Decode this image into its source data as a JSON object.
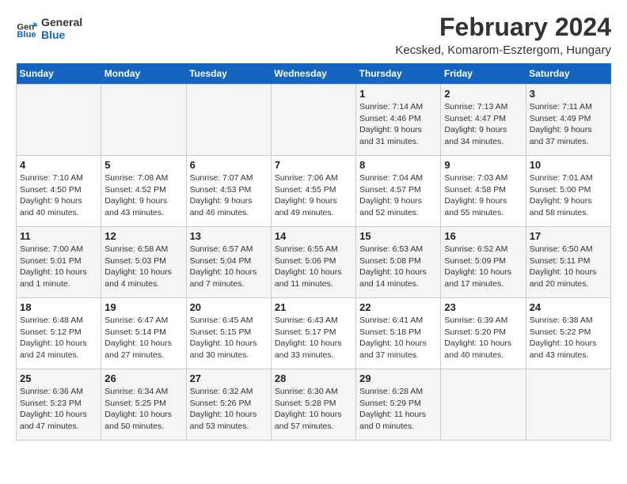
{
  "logo": {
    "line1": "General",
    "line2": "Blue"
  },
  "title": "February 2024",
  "subtitle": "Kecsked, Komarom-Esztergom, Hungary",
  "days_of_week": [
    "Sunday",
    "Monday",
    "Tuesday",
    "Wednesday",
    "Thursday",
    "Friday",
    "Saturday"
  ],
  "weeks": [
    [
      {
        "day": "",
        "info": ""
      },
      {
        "day": "",
        "info": ""
      },
      {
        "day": "",
        "info": ""
      },
      {
        "day": "",
        "info": ""
      },
      {
        "day": "1",
        "info": "Sunrise: 7:14 AM\nSunset: 4:46 PM\nDaylight: 9 hours\nand 31 minutes."
      },
      {
        "day": "2",
        "info": "Sunrise: 7:13 AM\nSunset: 4:47 PM\nDaylight: 9 hours\nand 34 minutes."
      },
      {
        "day": "3",
        "info": "Sunrise: 7:11 AM\nSunset: 4:49 PM\nDaylight: 9 hours\nand 37 minutes."
      }
    ],
    [
      {
        "day": "4",
        "info": "Sunrise: 7:10 AM\nSunset: 4:50 PM\nDaylight: 9 hours\nand 40 minutes."
      },
      {
        "day": "5",
        "info": "Sunrise: 7:08 AM\nSunset: 4:52 PM\nDaylight: 9 hours\nand 43 minutes."
      },
      {
        "day": "6",
        "info": "Sunrise: 7:07 AM\nSunset: 4:53 PM\nDaylight: 9 hours\nand 46 minutes."
      },
      {
        "day": "7",
        "info": "Sunrise: 7:06 AM\nSunset: 4:55 PM\nDaylight: 9 hours\nand 49 minutes."
      },
      {
        "day": "8",
        "info": "Sunrise: 7:04 AM\nSunset: 4:57 PM\nDaylight: 9 hours\nand 52 minutes."
      },
      {
        "day": "9",
        "info": "Sunrise: 7:03 AM\nSunset: 4:58 PM\nDaylight: 9 hours\nand 55 minutes."
      },
      {
        "day": "10",
        "info": "Sunrise: 7:01 AM\nSunset: 5:00 PM\nDaylight: 9 hours\nand 58 minutes."
      }
    ],
    [
      {
        "day": "11",
        "info": "Sunrise: 7:00 AM\nSunset: 5:01 PM\nDaylight: 10 hours\nand 1 minute."
      },
      {
        "day": "12",
        "info": "Sunrise: 6:58 AM\nSunset: 5:03 PM\nDaylight: 10 hours\nand 4 minutes."
      },
      {
        "day": "13",
        "info": "Sunrise: 6:57 AM\nSunset: 5:04 PM\nDaylight: 10 hours\nand 7 minutes."
      },
      {
        "day": "14",
        "info": "Sunrise: 6:55 AM\nSunset: 5:06 PM\nDaylight: 10 hours\nand 11 minutes."
      },
      {
        "day": "15",
        "info": "Sunrise: 6:53 AM\nSunset: 5:08 PM\nDaylight: 10 hours\nand 14 minutes."
      },
      {
        "day": "16",
        "info": "Sunrise: 6:52 AM\nSunset: 5:09 PM\nDaylight: 10 hours\nand 17 minutes."
      },
      {
        "day": "17",
        "info": "Sunrise: 6:50 AM\nSunset: 5:11 PM\nDaylight: 10 hours\nand 20 minutes."
      }
    ],
    [
      {
        "day": "18",
        "info": "Sunrise: 6:48 AM\nSunset: 5:12 PM\nDaylight: 10 hours\nand 24 minutes."
      },
      {
        "day": "19",
        "info": "Sunrise: 6:47 AM\nSunset: 5:14 PM\nDaylight: 10 hours\nand 27 minutes."
      },
      {
        "day": "20",
        "info": "Sunrise: 6:45 AM\nSunset: 5:15 PM\nDaylight: 10 hours\nand 30 minutes."
      },
      {
        "day": "21",
        "info": "Sunrise: 6:43 AM\nSunset: 5:17 PM\nDaylight: 10 hours\nand 33 minutes."
      },
      {
        "day": "22",
        "info": "Sunrise: 6:41 AM\nSunset: 5:18 PM\nDaylight: 10 hours\nand 37 minutes."
      },
      {
        "day": "23",
        "info": "Sunrise: 6:39 AM\nSunset: 5:20 PM\nDaylight: 10 hours\nand 40 minutes."
      },
      {
        "day": "24",
        "info": "Sunrise: 6:38 AM\nSunset: 5:22 PM\nDaylight: 10 hours\nand 43 minutes."
      }
    ],
    [
      {
        "day": "25",
        "info": "Sunrise: 6:36 AM\nSunset: 5:23 PM\nDaylight: 10 hours\nand 47 minutes."
      },
      {
        "day": "26",
        "info": "Sunrise: 6:34 AM\nSunset: 5:25 PM\nDaylight: 10 hours\nand 50 minutes."
      },
      {
        "day": "27",
        "info": "Sunrise: 6:32 AM\nSunset: 5:26 PM\nDaylight: 10 hours\nand 53 minutes."
      },
      {
        "day": "28",
        "info": "Sunrise: 6:30 AM\nSunset: 5:28 PM\nDaylight: 10 hours\nand 57 minutes."
      },
      {
        "day": "29",
        "info": "Sunrise: 6:28 AM\nSunset: 5:29 PM\nDaylight: 11 hours\nand 0 minutes."
      },
      {
        "day": "",
        "info": ""
      },
      {
        "day": "",
        "info": ""
      }
    ]
  ]
}
